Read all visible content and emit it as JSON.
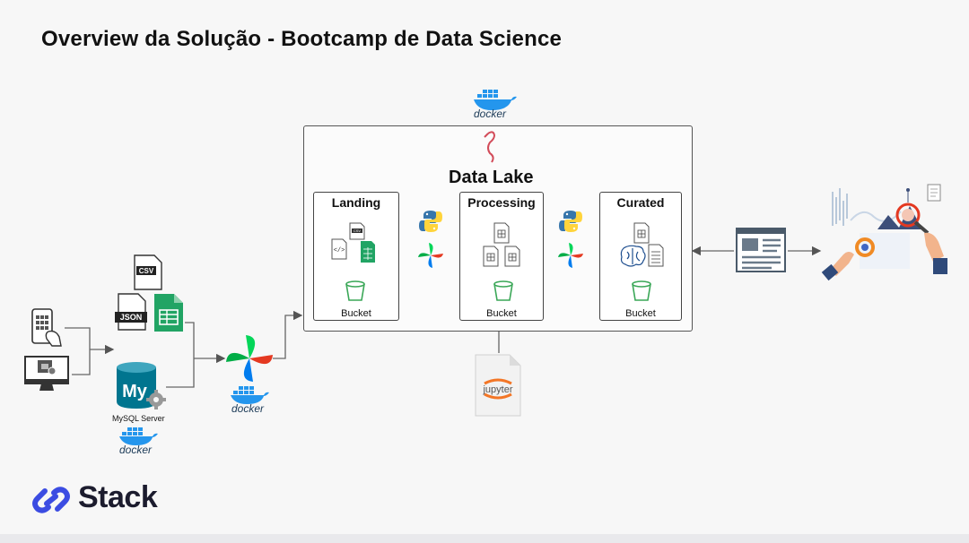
{
  "slide": {
    "title": "Overview da Solução - Bootcamp de Data Science",
    "brand": "Stack"
  },
  "datalake": {
    "title": "Data Lake",
    "zones": [
      {
        "name": "Landing",
        "bucket": "Bucket"
      },
      {
        "name": "Processing",
        "bucket": "Bucket"
      },
      {
        "name": "Curated",
        "bucket": "Bucket"
      }
    ]
  },
  "sources": {
    "csv_label": "CSV",
    "json_label": "JSON",
    "mysql_logo": "My",
    "mysql_label": "MySQL Server"
  },
  "labels": {
    "docker": "docker",
    "jupyter": "jupyter",
    "csv_small": "CSV"
  },
  "colors": {
    "docker_blue": "#2496ed",
    "python_blue": "#3776ab",
    "python_yellow": "#ffd43b",
    "airflow_red": "#e43921",
    "airflow_blue": "#017cee",
    "airflow_green": "#00ad46",
    "airflow_teal": "#04d659",
    "sheets_green": "#21a464",
    "bucket_green": "#3aa757",
    "mysql_blue": "#00758f",
    "jupyter_orange": "#f37626",
    "brand_blue": "#3b4ce2",
    "flamingo_red": "#d24b59"
  }
}
